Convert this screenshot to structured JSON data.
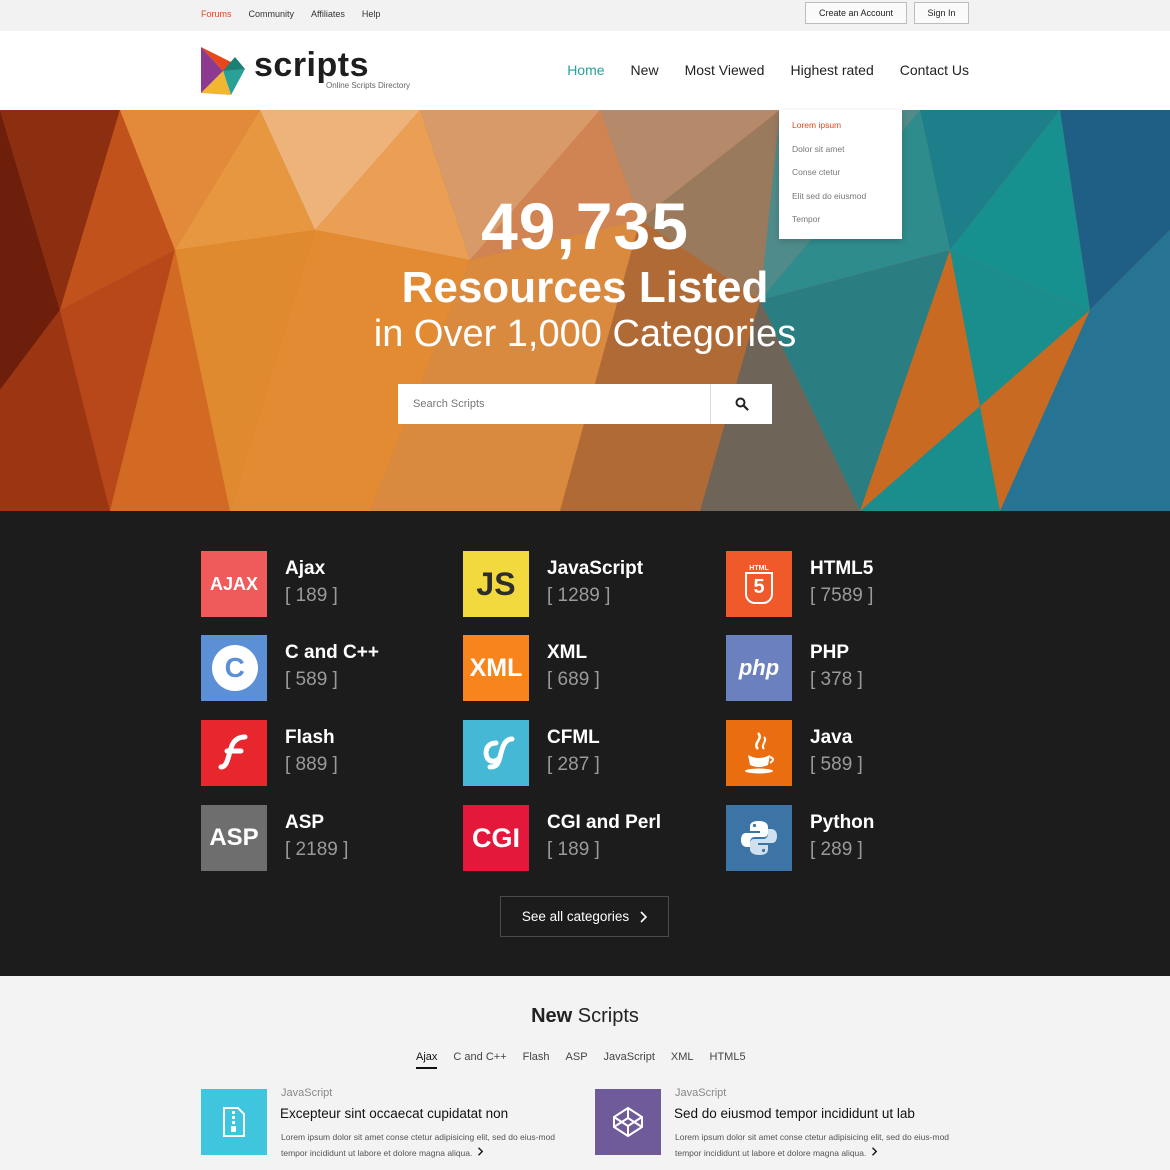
{
  "topbar": {
    "links": [
      "Forums",
      "Community",
      "Affiliates",
      "Help"
    ],
    "create_account": "Create an Account",
    "sign_in": "Sign In"
  },
  "brand": {
    "name": "scripts",
    "tagline": "Online Scripts Directory"
  },
  "nav": [
    "Home",
    "New",
    "Most Viewed",
    "Highest rated",
    "Contact Us"
  ],
  "dropdown": [
    "Lorem ipsum",
    "Dolor sit amet",
    "Conse ctetur",
    "Elit sed do eiusmod",
    "Tempor"
  ],
  "hero": {
    "count": "49,735",
    "title": "Resources Listed",
    "subtitle": "in Over 1,000 Categories",
    "search_placeholder": "Search Scripts"
  },
  "categories": [
    {
      "name": "Ajax",
      "count": "[ 189 ]",
      "icon": "ajax-icon",
      "color": "#ef5b5b"
    },
    {
      "name": "JavaScript",
      "count": "[ 1289 ]",
      "icon": "js-icon",
      "color": "#f2d93d"
    },
    {
      "name": "HTML5",
      "count": "[ 7589 ]",
      "icon": "html5-icon",
      "color": "#f0592a"
    },
    {
      "name": "C and C++",
      "count": "[ 589 ]",
      "icon": "cpp-icon",
      "color": "#5b8fd6"
    },
    {
      "name": "XML",
      "count": "[ 689 ]",
      "icon": "xml-icon",
      "color": "#f7841c"
    },
    {
      "name": "PHP",
      "count": "[ 378 ]",
      "icon": "php-icon",
      "color": "#6b80bf"
    },
    {
      "name": "Flash",
      "count": "[ 889 ]",
      "icon": "flash-icon",
      "color": "#e8262e"
    },
    {
      "name": "CFML",
      "count": "[ 287 ]",
      "icon": "cfml-icon",
      "color": "#45b8d6"
    },
    {
      "name": "Java",
      "count": "[ 589 ]",
      "icon": "java-icon",
      "color": "#ea6d0f"
    },
    {
      "name": "ASP",
      "count": "[ 2189 ]",
      "icon": "asp-icon",
      "color": "#6e6e6e"
    },
    {
      "name": "CGI and Perl",
      "count": "[ 189 ]",
      "icon": "cgi-icon",
      "color": "#e3183b"
    },
    {
      "name": "Python",
      "count": "[ 289 ]",
      "icon": "python-icon",
      "color": "#3c74a6"
    }
  ],
  "icon_text": {
    "ajax": "AJAX",
    "js": "JS",
    "cpp": "C",
    "cpp_sup": "++",
    "xml": "XML",
    "php": "php",
    "asp": "ASP",
    "cgi": "CGI",
    "html5_label": "HTML",
    "html5_five": "5"
  },
  "see_all": "See all categories",
  "new_scripts": {
    "title_bold": "New",
    "title_rest": "Scripts",
    "tabs": [
      "Ajax",
      "C and C++",
      "Flash",
      "ASP",
      "JavaScript",
      "XML",
      "HTML5"
    ],
    "cards": [
      {
        "lang": "JavaScript",
        "title": "Excepteur sint occaecat cupidatat non",
        "desc": "Lorem ipsum dolor sit amet conse ctetur adipisicing elit, sed do eius-mod tempor incididunt ut labore et dolore magna aliqua.",
        "color": "#3fc6de"
      },
      {
        "lang": "JavaScript",
        "title": "Sed do eiusmod tempor incididunt ut lab",
        "desc": "Lorem ipsum dolor sit amet conse ctetur adipisicing elit, sed do eius-mod tempor incididunt ut labore et dolore magna aliqua.",
        "color": "#6f5a9a"
      }
    ]
  }
}
